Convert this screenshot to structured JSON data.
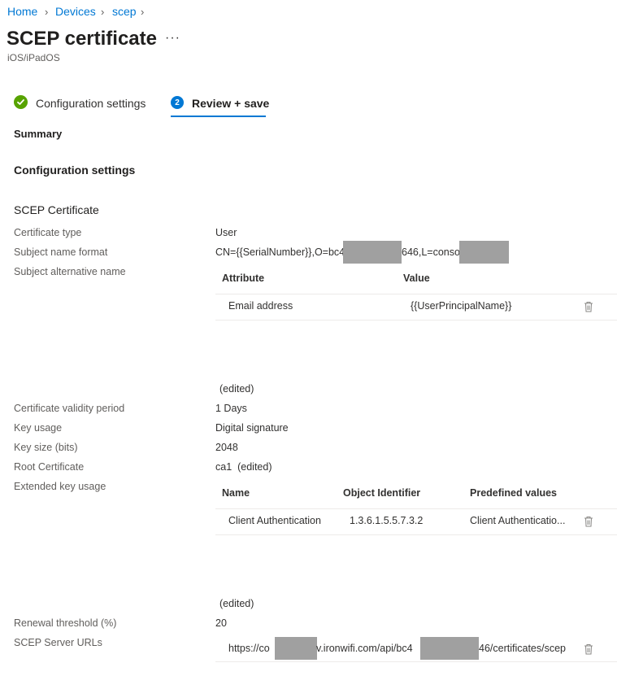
{
  "breadcrumb": [
    "Home",
    "Devices",
    "scep"
  ],
  "page": {
    "title": "SCEP certificate",
    "more": "···",
    "subtitle": "iOS/iPadOS"
  },
  "steps": [
    {
      "label": "Configuration settings",
      "state": "complete"
    },
    {
      "number": "2",
      "label": "Review + save",
      "state": "active"
    }
  ],
  "summary": {
    "heading": "Summary",
    "config_heading": "Configuration settings",
    "section": "SCEP Certificate"
  },
  "fields": {
    "certificate_type": {
      "label": "Certificate type",
      "value": "User"
    },
    "subject_name_format": {
      "label": "Subject name format",
      "value_a": "CN={{SerialNumber}},O=bc4",
      "value_b": "646,L=conso"
    },
    "subject_alt_name": {
      "label": "Subject alternative name"
    },
    "san_edited": "(edited)",
    "validity": {
      "label": "Certificate validity period",
      "value": "1 Days"
    },
    "key_usage": {
      "label": "Key usage",
      "value": "Digital signature"
    },
    "key_size": {
      "label": "Key size (bits)",
      "value": "2048"
    },
    "root_cert": {
      "label": "Root Certificate",
      "value": "ca1  (edited)"
    },
    "eku": {
      "label": "Extended key usage"
    },
    "eku_edited": "(edited)",
    "renewal": {
      "label": "Renewal threshold (%)",
      "value": "20"
    },
    "scep_urls": {
      "label": "SCEP Server URLs",
      "url_a": "https://co",
      "url_b": "v.ironwifi.com/api/bc4",
      "url_c": "46/certificates/scep"
    }
  },
  "san_table": {
    "headers": [
      "Attribute",
      "Value"
    ],
    "rows": [
      {
        "attribute": "Email address",
        "value": "{{UserPrincipalName}}"
      }
    ]
  },
  "eku_table": {
    "headers": [
      "Name",
      "Object Identifier",
      "Predefined values"
    ],
    "rows": [
      {
        "name": "Client Authentication",
        "oid": "1.3.6.1.5.5.7.3.2",
        "predefined": "Client Authenticatio..."
      }
    ]
  },
  "colors": {
    "link": "#0078d4",
    "success": "#57a300",
    "accent": "#0078d4"
  },
  "icons": {
    "delete": "trash-icon",
    "complete": "checkmark-icon"
  }
}
